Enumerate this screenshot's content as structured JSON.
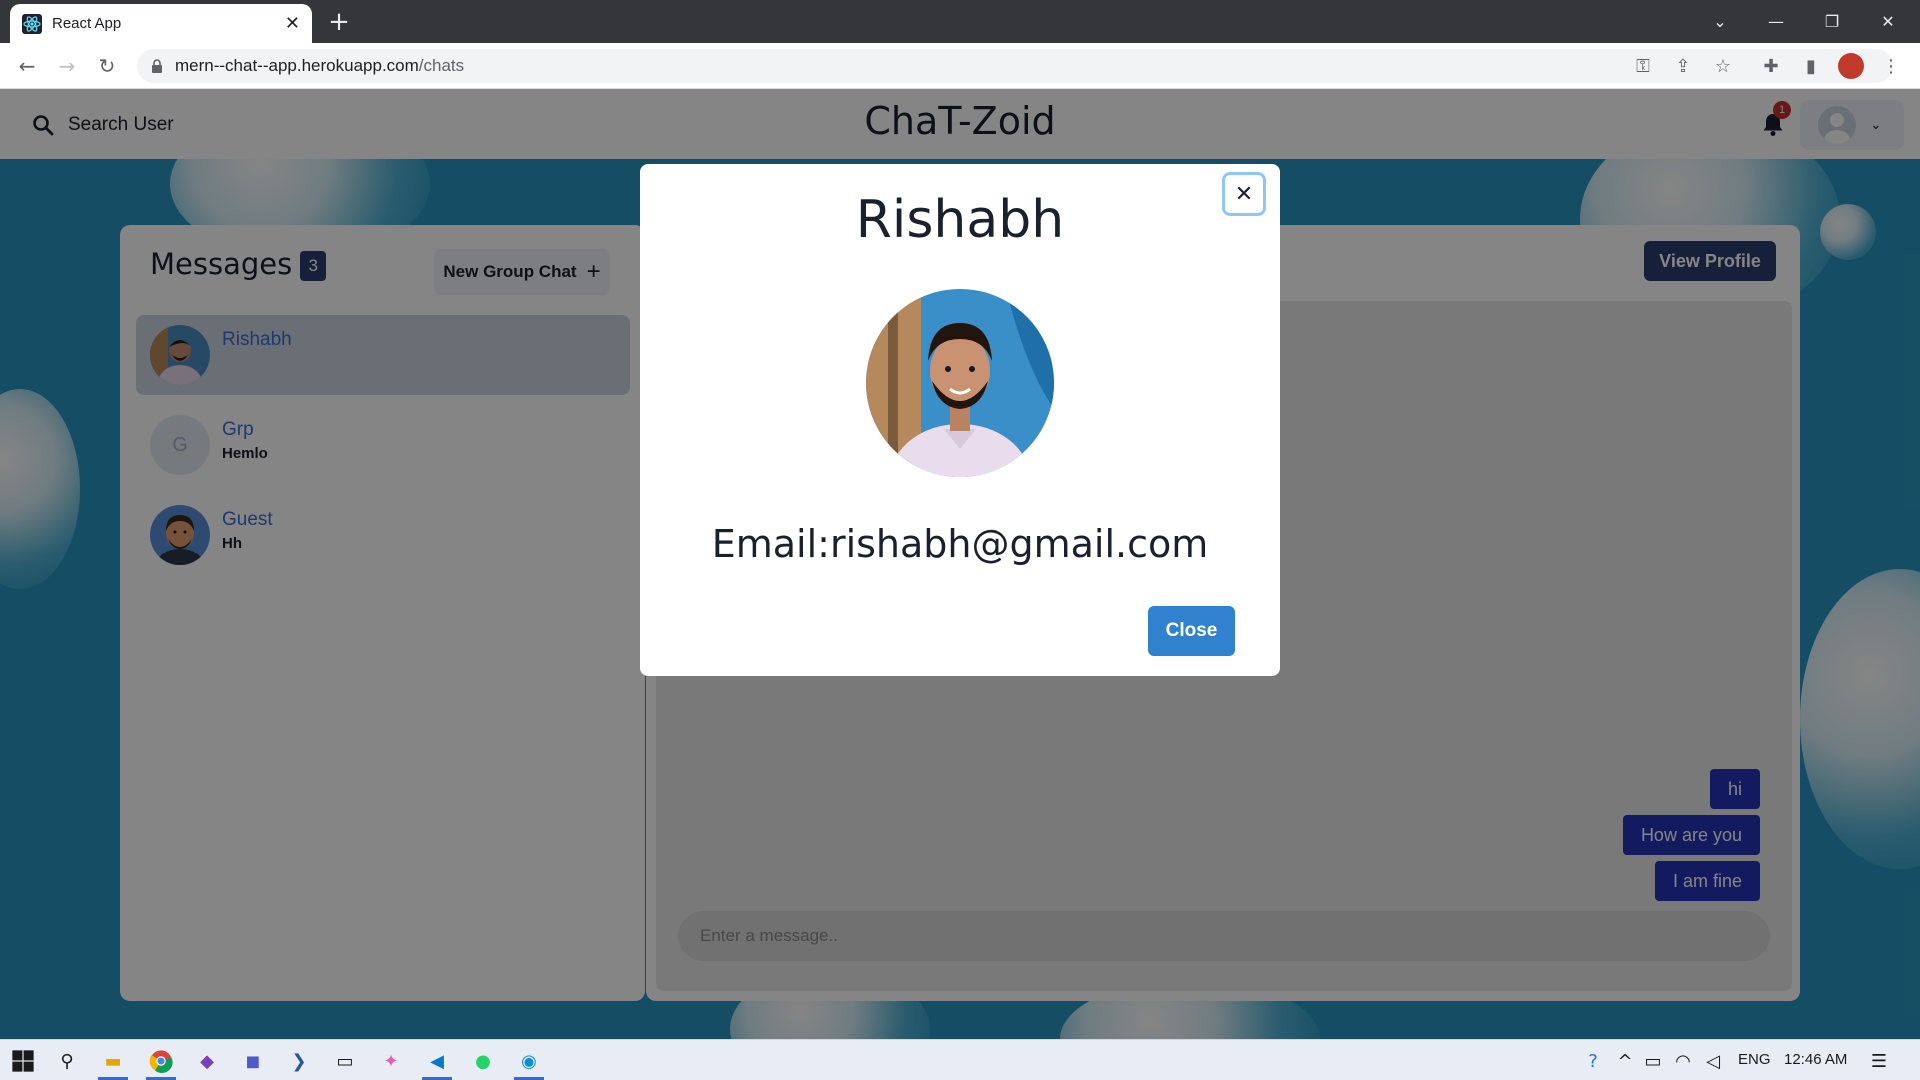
{
  "browser": {
    "tab_title": "React App",
    "url_host": "mern--chat--app.herokuapp.com",
    "url_path": "/chats"
  },
  "header": {
    "search_label": "Search User",
    "brand": "ChaT-Zoid",
    "notification_count": "1"
  },
  "chats": {
    "title": "Messages",
    "count": "3",
    "new_group_label": "New Group Chat",
    "items": [
      {
        "name": "Rishabh",
        "last_message": "",
        "active": true
      },
      {
        "name": "Grp",
        "last_message": "Hemlo",
        "avatar_letter": "G"
      },
      {
        "name": "Guest",
        "last_message": "Hh"
      }
    ]
  },
  "conversation": {
    "view_profile_label": "View Profile",
    "messages": [
      "hi",
      "How are you",
      "I am fine"
    ],
    "input_placeholder": "Enter a message.."
  },
  "modal": {
    "title": "Rishabh",
    "email": "Email:rishabh@gmail.com",
    "close_label": "Close"
  },
  "taskbar": {
    "language": "ENG",
    "time": "12:46 AM"
  },
  "colors": {
    "accent_dark": "#2c3e70",
    "close_button": "#3182ce",
    "message_bubble": "#2633b8",
    "background": "#2a96c0"
  }
}
